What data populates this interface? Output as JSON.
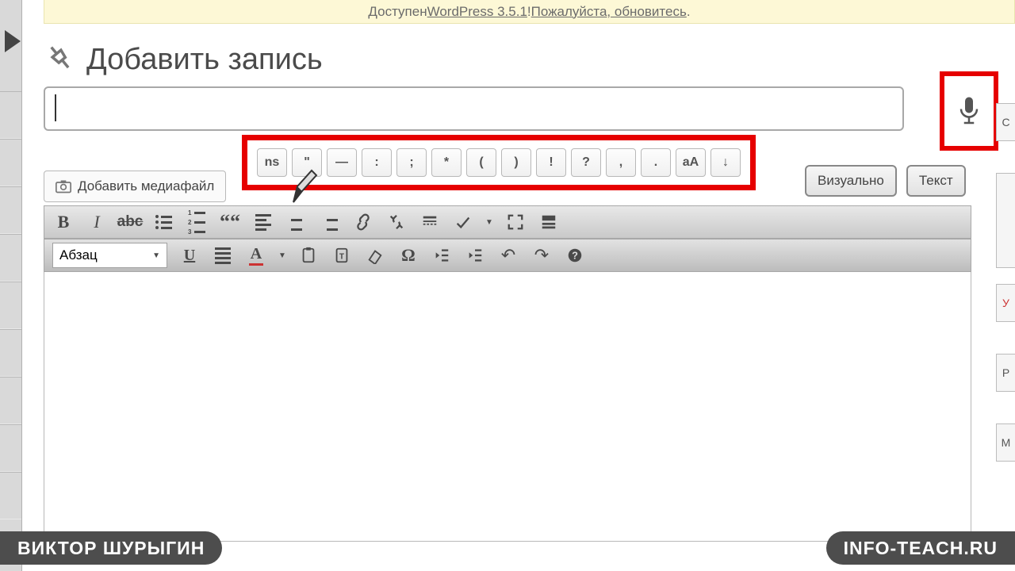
{
  "notice": {
    "prefix": "Доступен ",
    "link1": "WordPress 3.5.1",
    "mid": "! ",
    "link2": "Пожалуйста, обновитесь",
    "suffix": "."
  },
  "page": {
    "title": "Добавить запись"
  },
  "title_input": {
    "value": "",
    "placeholder": ""
  },
  "media_button": {
    "label": "Добавить медиафайл"
  },
  "symbol_bar": [
    "ns",
    "\"",
    "—",
    ":",
    ";",
    "*",
    "(",
    ")",
    "!",
    "?",
    ",",
    ".",
    "aA",
    "↓"
  ],
  "tabs": {
    "visual": "Визуально",
    "text": "Текст"
  },
  "format_select": {
    "value": "Абзац"
  },
  "icons": {
    "bold": "B",
    "italic": "I",
    "strike": "abc",
    "quote": "““",
    "underline": "U",
    "omega": "Ω",
    "colorA": "A",
    "question": "?",
    "undo": "↶",
    "redo": "↷"
  },
  "author_badge": "ВИКТОР ШУРЫГИН",
  "site_badge": "INFO-TEACH.RU",
  "right_strip": [
    "С",
    "",
    "",
    "У",
    "Р",
    "М"
  ]
}
